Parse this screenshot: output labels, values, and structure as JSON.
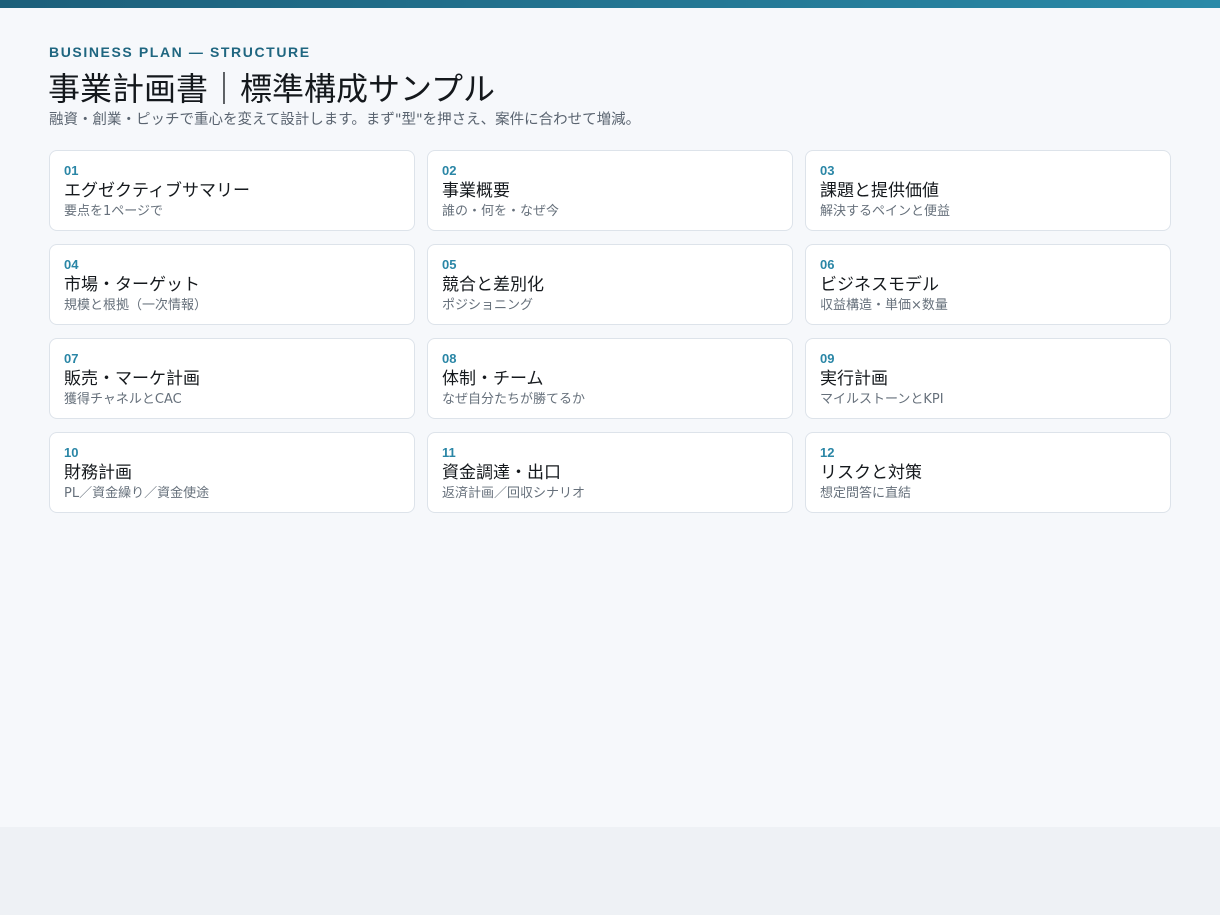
{
  "header": {
    "eyebrow": "BUSINESS PLAN — STRUCTURE",
    "title": "事業計画書｜標準構成サンプル",
    "subtitle": "融資・創業・ピッチで重心を変えて設計します。まず\"型\"を押さえ、案件に合わせて増減。"
  },
  "colors": {
    "accent": "#2a86a6",
    "accent_dark": "#1c5f7a",
    "card_border": "#dde3ea",
    "background": "#f6f8fb"
  },
  "sections": [
    {
      "num": "01",
      "title": "エグゼクティブサマリー",
      "desc": "要点を1ページで"
    },
    {
      "num": "02",
      "title": "事業概要",
      "desc": "誰の・何を・なぜ今"
    },
    {
      "num": "03",
      "title": "課題と提供価値",
      "desc": "解決するペインと便益"
    },
    {
      "num": "04",
      "title": "市場・ターゲット",
      "desc": "規模と根拠（一次情報）"
    },
    {
      "num": "05",
      "title": "競合と差別化",
      "desc": "ポジショニング"
    },
    {
      "num": "06",
      "title": "ビジネスモデル",
      "desc": "収益構造・単価×数量"
    },
    {
      "num": "07",
      "title": "販売・マーケ計画",
      "desc": "獲得チャネルとCAC"
    },
    {
      "num": "08",
      "title": "体制・チーム",
      "desc": "なぜ自分たちが勝てるか"
    },
    {
      "num": "09",
      "title": "実行計画",
      "desc": "マイルストーンとKPI"
    },
    {
      "num": "10",
      "title": "財務計画",
      "desc": "PL／資金繰り／資金使途"
    },
    {
      "num": "11",
      "title": "資金調達・出口",
      "desc": "返済計画／回収シナリオ"
    },
    {
      "num": "12",
      "title": "リスクと対策",
      "desc": "想定問答に直結"
    }
  ]
}
